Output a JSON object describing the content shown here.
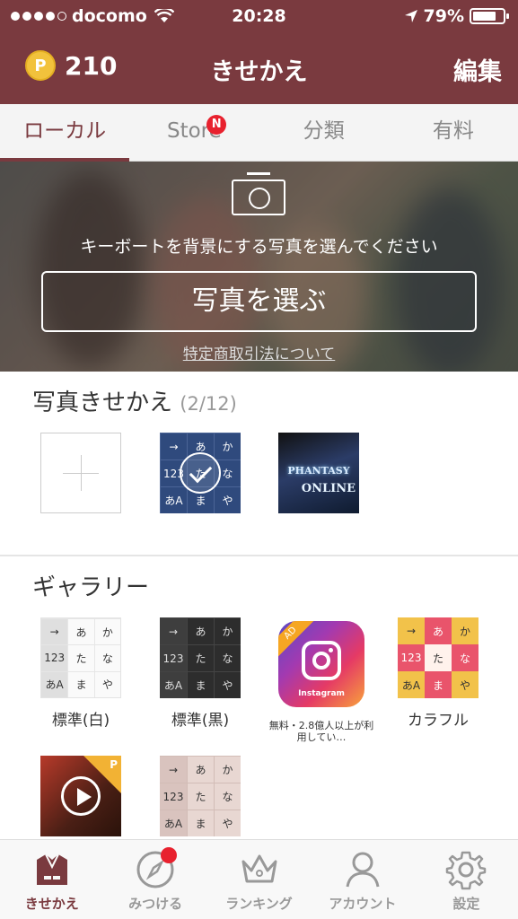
{
  "status_bar": {
    "carrier": "docomo",
    "time": "20:28",
    "battery": "79%",
    "battery_level": 0.79
  },
  "header": {
    "points": "210",
    "coin_symbol": "P",
    "title": "きせかえ",
    "edit_label": "編集"
  },
  "tabs": [
    {
      "label": "ローカル",
      "active": true
    },
    {
      "label": "Store",
      "badge": "N"
    },
    {
      "label": "分類"
    },
    {
      "label": "有料"
    }
  ],
  "hero": {
    "prompt": "キーボートを背景にする写真を選んでください",
    "button_label": "写真を選ぶ",
    "link_label": "特定商取引法について"
  },
  "photo_section": {
    "title": "写真きせかえ",
    "count": "(2/12)",
    "game_title": "PHANTASY",
    "game_sub": "ONLINE"
  },
  "keyboard_keys": [
    "→",
    "あ",
    "か",
    "123",
    "た",
    "な",
    "あA",
    "ま",
    "や"
  ],
  "gallery": {
    "title": "ギャラリー",
    "items": [
      {
        "label": "標準(白)"
      },
      {
        "label": "標準(黒)"
      },
      {
        "label": "無料・2.8億人以上が利用してい…",
        "icon_label": "Instagram",
        "ad": "AD"
      },
      {
        "label": "カラフル"
      }
    ],
    "corner_badge": "P"
  },
  "tabbar": [
    {
      "label": "きせかえ",
      "icon": "shirt-icon",
      "active": true
    },
    {
      "label": "みつける",
      "icon": "compass-icon",
      "dot": true
    },
    {
      "label": "ランキング",
      "icon": "crown-icon"
    },
    {
      "label": "アカウント",
      "icon": "person-icon"
    },
    {
      "label": "設定",
      "icon": "gear-icon"
    }
  ],
  "colors": {
    "brand": "#7a3a3f",
    "badge": "#e8212e",
    "coin": "#f2c23c"
  }
}
